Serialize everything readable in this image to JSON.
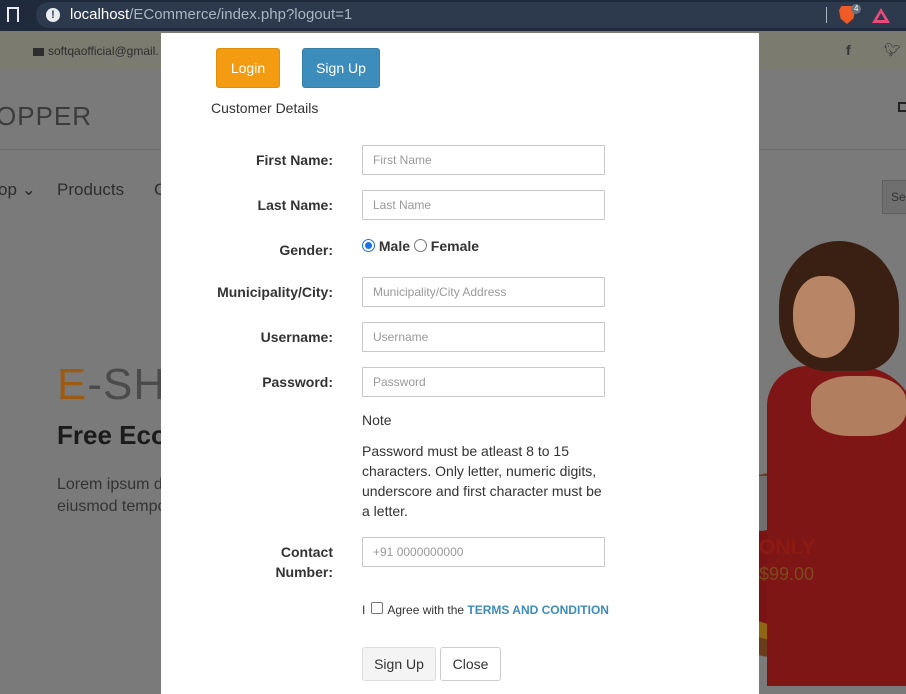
{
  "browser": {
    "url_host": "localhost",
    "url_path": "/ECommerce/index.php?logout=1",
    "shield_count": "4"
  },
  "background": {
    "email": "softqaofficial@gmail.",
    "logo": "OPPER",
    "nav": [
      "op ⌄",
      "Products",
      "C"
    ],
    "search_placeholder": "Se",
    "hero_title_first": "E",
    "hero_title_rest": "-SHO",
    "hero_subtitle": "Free Eco",
    "hero_text_line1": "Lorem ipsum d",
    "hero_text_line2": "eiusmod tempo",
    "promo_only": "ONLY",
    "promo_price": "$99.00"
  },
  "modal": {
    "login_button": "Login",
    "signup_top_button": "Sign Up",
    "section_title": "Customer Details",
    "fields": {
      "first_name": {
        "label": "First Name:",
        "placeholder": "First Name"
      },
      "last_name": {
        "label": "Last Name:",
        "placeholder": "Last Name"
      },
      "gender": {
        "label": "Gender:",
        "options": [
          "Male",
          "Female"
        ],
        "selected": "Male"
      },
      "city": {
        "label": "Municipality/City:",
        "placeholder": "Municipality/City Address"
      },
      "username": {
        "label": "Username:",
        "placeholder": "Username"
      },
      "password": {
        "label": "Password:",
        "placeholder": "Password"
      },
      "contact": {
        "label_line1": "Contact",
        "label_line2": "Number:",
        "placeholder": "+91 0000000000"
      }
    },
    "note_title": "Note",
    "note_text": "Password must be atleast 8 to 15 characters. Only letter, numeric digits, underscore and first character must be a letter.",
    "terms_prefix": "I",
    "terms_text": "Agree with the",
    "terms_link": "TERMS AND CONDITION",
    "signup_button": "Sign Up",
    "close_button": "Close"
  }
}
